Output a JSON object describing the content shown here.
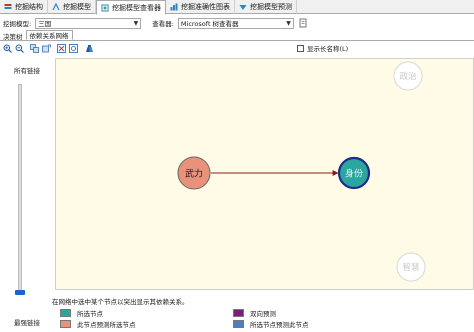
{
  "tabs": [
    {
      "label": "挖掘结构",
      "icon": "mining-structure-icon",
      "active": false
    },
    {
      "label": "挖掘模型",
      "icon": "mining-model-icon",
      "active": false
    },
    {
      "label": "挖掘模型查看器",
      "icon": "model-viewer-icon",
      "active": true
    },
    {
      "label": "挖掘准确性图表",
      "icon": "accuracy-chart-icon",
      "active": false
    },
    {
      "label": "挖掘模型预测",
      "icon": "prediction-icon",
      "active": false
    }
  ],
  "selectors": {
    "model_label": "挖掘模型:",
    "model_value": "三国",
    "viewer_label": "查看器:",
    "viewer_value": "Microsoft 树查看器"
  },
  "subtabs": [
    {
      "label": "决策树",
      "active": false
    },
    {
      "label": "依赖关系网络",
      "active": true
    }
  ],
  "toolbar": {
    "show_long_names": "显示长名称(L)"
  },
  "slider": {
    "top_label": "所有链接",
    "bottom_label": "最强链接",
    "level": 0.0
  },
  "network": {
    "nodes": {
      "wuli": {
        "label": "武力",
        "role": "predicts-selected"
      },
      "shenfen": {
        "label": "身份",
        "role": "selected"
      },
      "zhengzhi": {
        "label": "政治",
        "role": "none"
      },
      "zhihui": {
        "label": "智慧",
        "role": "none"
      }
    }
  },
  "legend": {
    "note": "在网络中选中某个节点以突出显示其依赖关系。",
    "items": [
      {
        "label": "所选节点",
        "color": "#2aa6a0"
      },
      {
        "label": "此节点预测所选节点",
        "color": "#e8927c"
      },
      {
        "label": "双向预测",
        "color": "#7a1f7a"
      },
      {
        "label": "所选节点预测此节点",
        "color": "#4f7fbf"
      }
    ]
  },
  "colors": {
    "canvas_bg": "#fffbe6",
    "edge": "#8b1a1a",
    "selected_border": "#1f2a8a"
  }
}
